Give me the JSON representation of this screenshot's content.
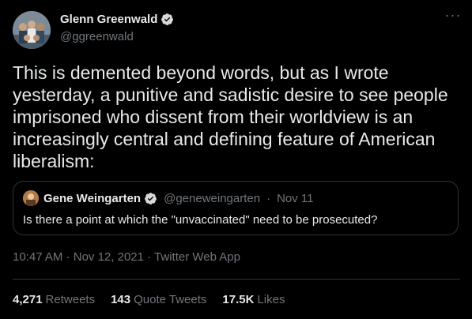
{
  "author": {
    "name": "Glenn Greenwald",
    "handle": "@ggreenwald",
    "verified_icon": "verified-badge-icon",
    "more_icon": "more-options-icon"
  },
  "tweet": {
    "text": "This is demented beyond words, but as I wrote\nyesterday, a punitive and sadistic desire to see people\nimprisoned who dissent from their worldview is an\nincreasingly central and defining feature of American\nliberalism:"
  },
  "quote": {
    "name": "Gene Weingarten",
    "handle": "@geneweingarten",
    "separator": "·",
    "date": "Nov 11",
    "text": "Is there a point at which the \"unvaccinated\" need to be prosecuted?"
  },
  "meta": {
    "time": "10:47 AM",
    "date": "Nov 12, 2021",
    "separator": "·",
    "source": "Twitter Web App"
  },
  "stats": {
    "retweets": {
      "count": "4,271",
      "label": "Retweets"
    },
    "quotes": {
      "count": "143",
      "label": "Quote Tweets"
    },
    "likes": {
      "count": "17.5K",
      "label": "Likes"
    }
  },
  "colors": {
    "background": "#000000",
    "text": "#e7e9ea",
    "secondary": "#71767b",
    "border": "#2f3336",
    "verified": "#d9d9d9"
  }
}
